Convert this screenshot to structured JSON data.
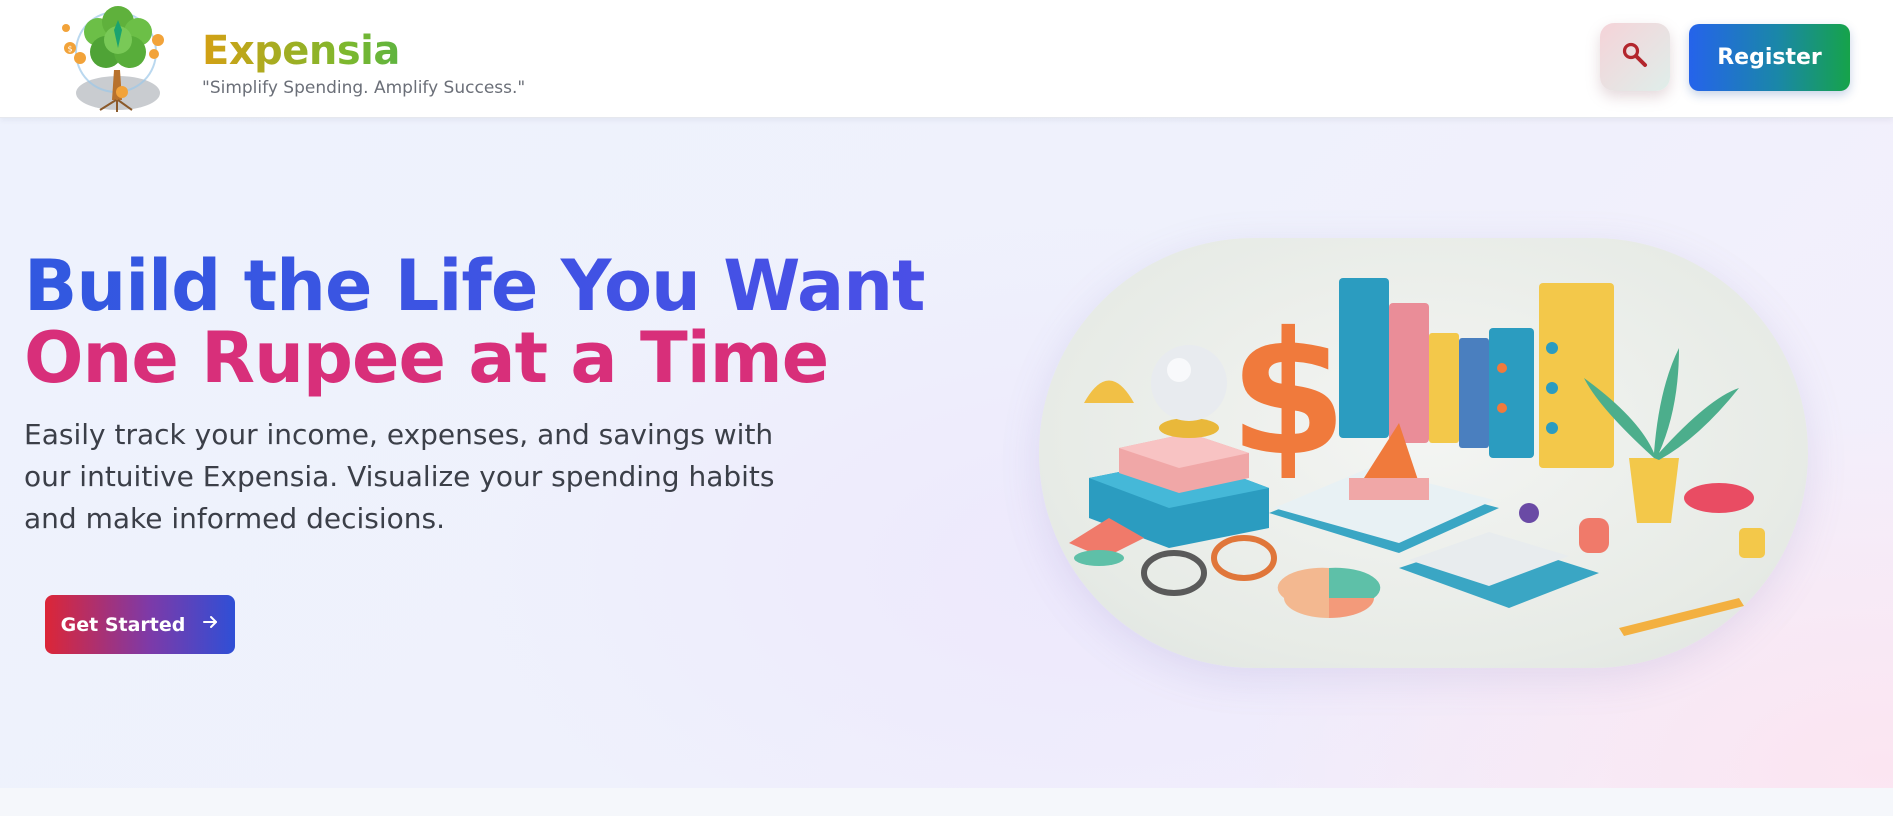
{
  "header": {
    "brand_name": "Expensia",
    "tagline": "\"Simplify Spending. Amplify Success.\"",
    "logo_icon": "money-tree-icon",
    "search_icon": "search-icon",
    "register_label": "Register"
  },
  "hero": {
    "title_line1": "Build the Life You Want",
    "title_line2": "One Rupee at a Time",
    "description": "Easily track your income, expenses, and savings with our intuitive Expensia. Visualize your spending habits and make informed decisions.",
    "cta_label": "Get Started",
    "cta_icon": "arrow-right-icon",
    "illustration": "finance-books-dollar-illustration"
  },
  "colors": {
    "title_blue": "#3158e0",
    "title_pink": "#d82f7a",
    "register_gradient_start": "#2563eb",
    "register_gradient_end": "#16a34a",
    "cta_gradient_start": "#dc2637",
    "cta_gradient_end": "#2f4fd6"
  }
}
